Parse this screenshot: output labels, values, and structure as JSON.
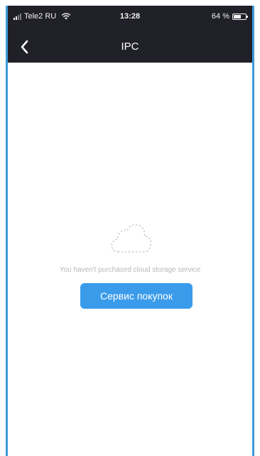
{
  "status_bar": {
    "carrier": "Tele2 RU",
    "time": "13:28",
    "battery_text": "64 %",
    "battery_level": 0.64
  },
  "nav": {
    "back_icon": "chevron-left-icon",
    "title": "IPC"
  },
  "empty_state": {
    "icon": "cloud-icon",
    "message": "You haven't purchased cloud storage service",
    "button_label": "Сервис покупок"
  },
  "colors": {
    "nav_background": "#202028",
    "accent": "#3a9bea",
    "frame_border": "#3a9bdc",
    "message_text": "#b8b8b8"
  }
}
